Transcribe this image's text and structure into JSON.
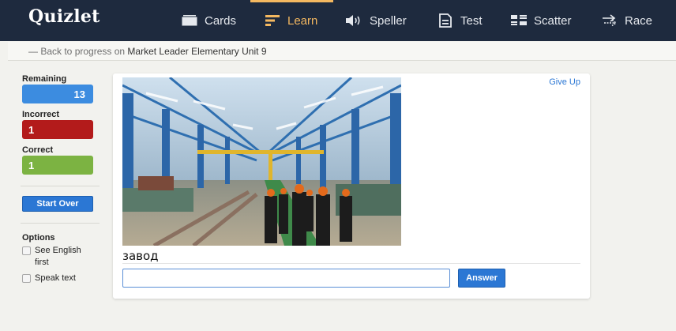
{
  "app": {
    "logo": "Quizlet"
  },
  "nav": {
    "items": [
      {
        "label": "Cards",
        "icon": "cards-icon"
      },
      {
        "label": "Learn",
        "icon": "learn-icon",
        "active": true
      },
      {
        "label": "Speller",
        "icon": "speaker-icon"
      },
      {
        "label": "Test",
        "icon": "test-icon"
      },
      {
        "label": "Scatter",
        "icon": "scatter-icon"
      },
      {
        "label": "Race",
        "icon": "race-icon"
      }
    ],
    "active_color": "#f4b860",
    "background": "#1e2a3e"
  },
  "back": {
    "prefix": "— Back to progress on",
    "set_name": "Market Leader Elementary Unit 9"
  },
  "sidebar": {
    "remaining_label": "Remaining",
    "remaining_value": "13",
    "incorrect_label": "Incorrect",
    "incorrect_value": "1",
    "correct_label": "Correct",
    "correct_value": "1",
    "start_over": "Start Over",
    "options_title": "Options",
    "option_see_english": "See English first",
    "option_speak_text": "Speak text"
  },
  "card": {
    "give_up": "Give Up",
    "term": "завод",
    "answer_value": "",
    "answer_button": "Answer"
  },
  "colors": {
    "remaining": "#3c8ce0",
    "incorrect": "#b31b1b",
    "correct": "#7cb342",
    "button": "#2b77d4"
  }
}
